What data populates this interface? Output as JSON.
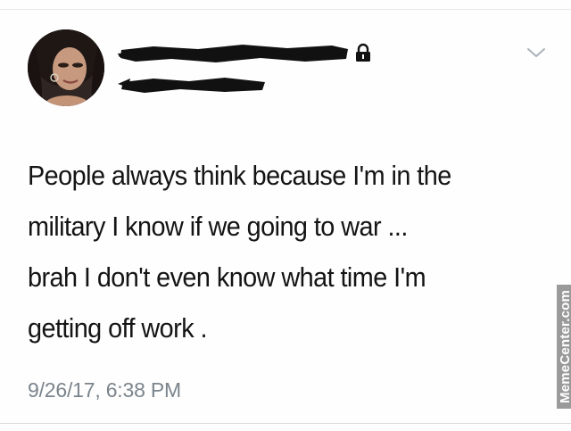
{
  "tweet": {
    "text": "People always think because I'm in the\nmilitary I know if we going to war ...\nbrah I don't even know what time I'm\ngetting off work .",
    "timestamp": "9/26/17, 6:38 PM"
  },
  "author": {
    "display_name_redacted": true,
    "handle_redacted": true,
    "protected_account_icon": "lock-icon"
  },
  "menu": {
    "icon": "chevron-down-icon"
  },
  "watermark": {
    "text": "MemeCenter.com"
  },
  "colors": {
    "text": "#141414",
    "muted": "#7b848c",
    "redaction": "#111111"
  }
}
